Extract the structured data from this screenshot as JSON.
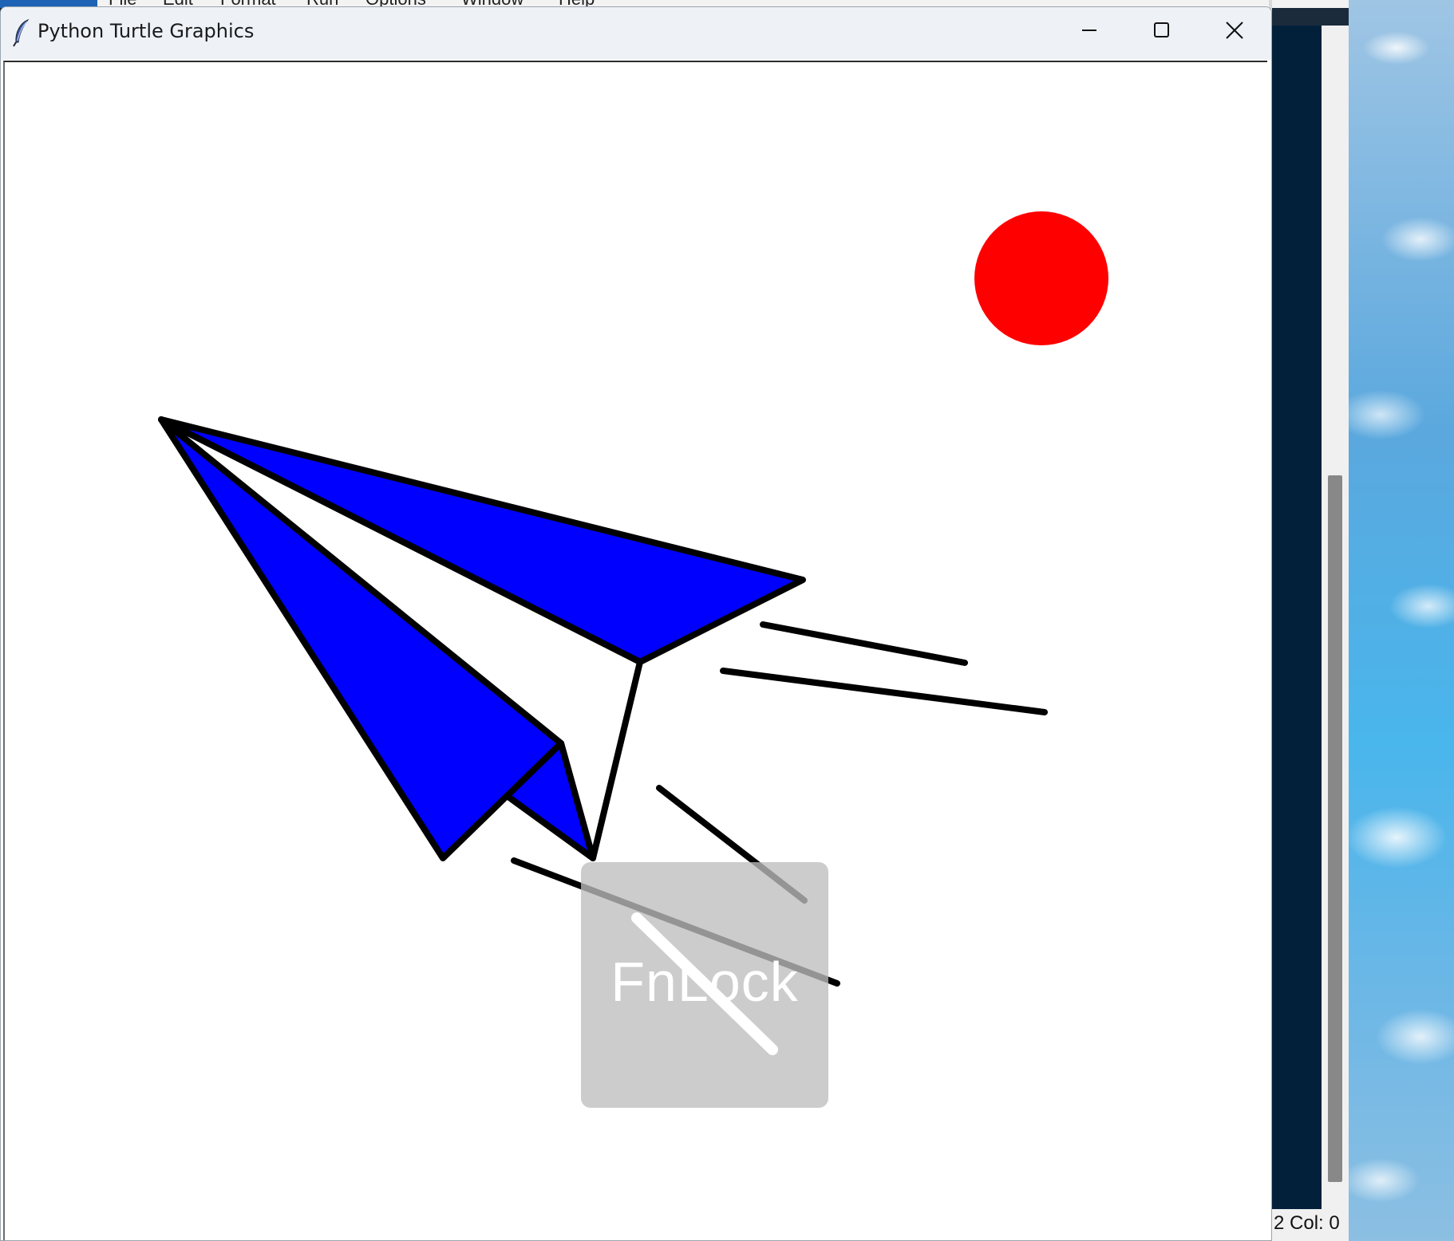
{
  "background_app": {
    "menu": [
      "File",
      "Edit",
      "Format",
      "Run",
      "Options",
      "Window",
      "Help"
    ],
    "status_text": "2  Col: 0"
  },
  "window": {
    "title": "Python Turtle Graphics",
    "icon": "feather-icon",
    "controls": {
      "minimize": "minimize-icon",
      "maximize": "maximize-icon",
      "close": "close-icon"
    }
  },
  "drawing": {
    "sun_color": "#ff0000",
    "plane_fill": "#0000ff",
    "stroke_color": "#000000",
    "background": "#ffffff"
  },
  "overlay": {
    "label": "FnLock",
    "icon": "fnlock-disabled-icon"
  }
}
